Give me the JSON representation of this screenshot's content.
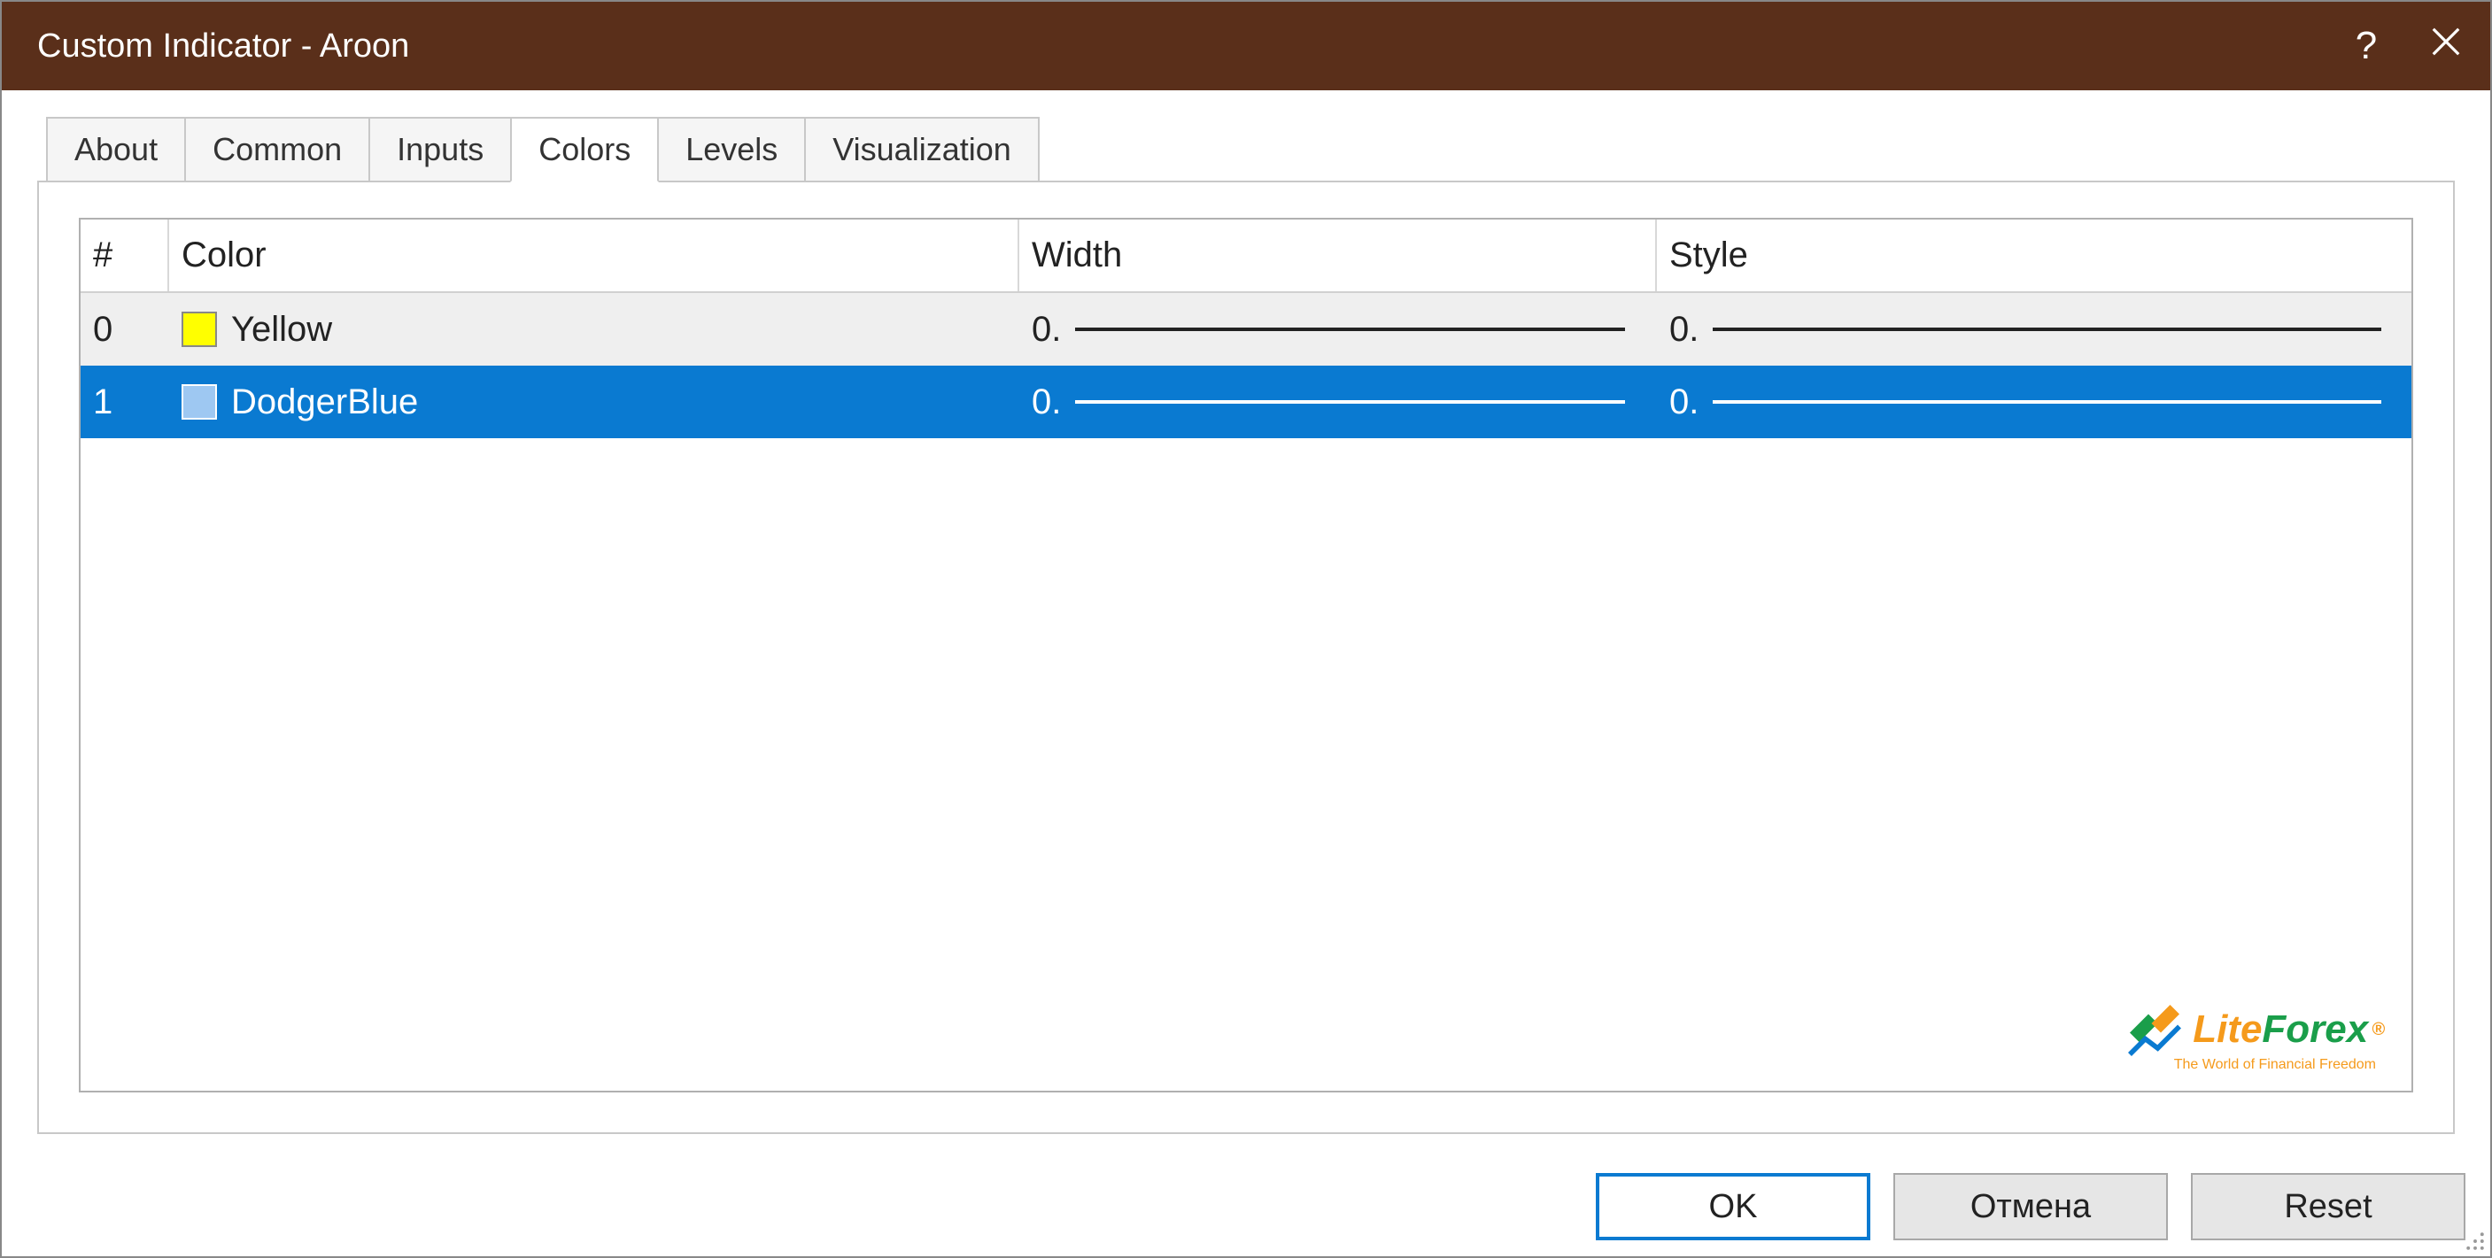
{
  "title": "Custom Indicator - Aroon",
  "tabs": {
    "about": "About",
    "common": "Common",
    "inputs": "Inputs",
    "colors": "Colors",
    "levels": "Levels",
    "visualization": "Visualization"
  },
  "table": {
    "headers": {
      "idx": "#",
      "color": "Color",
      "width": "Width",
      "style": "Style"
    },
    "rows": [
      {
        "idx": "0",
        "color_name": "Yellow",
        "color_hex": "#ffff00",
        "width_label": "0.",
        "style_label": "0.",
        "selected": false
      },
      {
        "idx": "1",
        "color_name": "DodgerBlue",
        "color_hex": "#9ec8f2",
        "width_label": "0.",
        "style_label": "0.",
        "selected": true
      }
    ]
  },
  "buttons": {
    "ok": "OK",
    "cancel": "Отмена",
    "reset": "Reset"
  },
  "watermark": {
    "lite": "Lite",
    "forex": "Forex",
    "tagline": "The World of Financial Freedom"
  }
}
